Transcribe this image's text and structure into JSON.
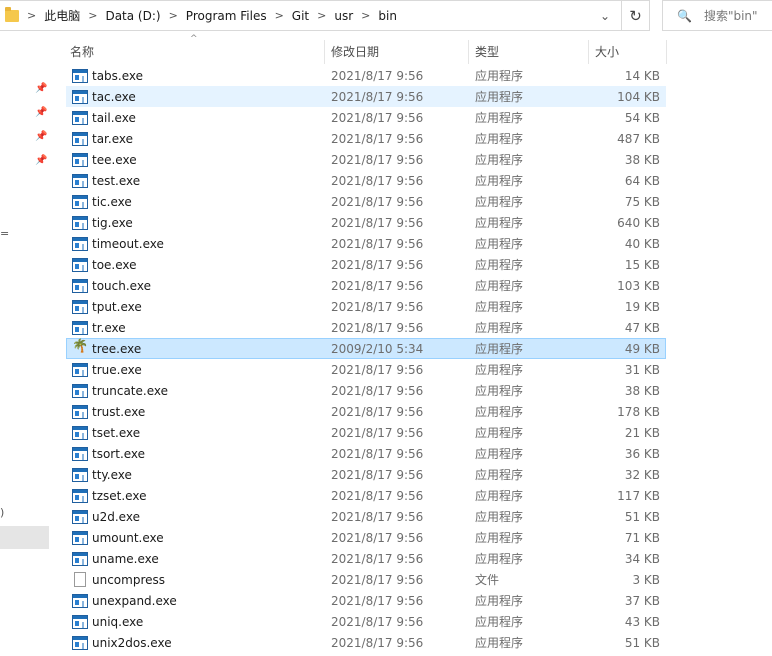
{
  "address_bar": {
    "breadcrumbs": [
      "此电脑",
      "Data (D:)",
      "Program Files",
      "Git",
      "usr",
      "bin"
    ],
    "separator": ">",
    "dropdown_glyph": "⌄",
    "refresh_glyph": "↻",
    "folder_icon": "folder-icon"
  },
  "search": {
    "placeholder": "搜索\"bin\"",
    "icon": "search-icon",
    "glyph": "🔍"
  },
  "nav_fragments": {
    "frag_a": "=",
    "frag_b": ")"
  },
  "columns": {
    "name": "名称",
    "date": "修改日期",
    "type": "类型",
    "size": "大小",
    "sort_indicator": "^"
  },
  "rows": [
    {
      "name": "tabs.exe",
      "date": "2021/8/17 9:56",
      "type": "应用程序",
      "size": "14 KB",
      "icon": "exe-icon"
    },
    {
      "name": "tac.exe",
      "date": "2021/8/17 9:56",
      "type": "应用程序",
      "size": "104 KB",
      "icon": "exe-icon",
      "state": "hover"
    },
    {
      "name": "tail.exe",
      "date": "2021/8/17 9:56",
      "type": "应用程序",
      "size": "54 KB",
      "icon": "exe-icon"
    },
    {
      "name": "tar.exe",
      "date": "2021/8/17 9:56",
      "type": "应用程序",
      "size": "487 KB",
      "icon": "exe-icon"
    },
    {
      "name": "tee.exe",
      "date": "2021/8/17 9:56",
      "type": "应用程序",
      "size": "38 KB",
      "icon": "exe-icon"
    },
    {
      "name": "test.exe",
      "date": "2021/8/17 9:56",
      "type": "应用程序",
      "size": "64 KB",
      "icon": "exe-icon"
    },
    {
      "name": "tic.exe",
      "date": "2021/8/17 9:56",
      "type": "应用程序",
      "size": "75 KB",
      "icon": "exe-icon"
    },
    {
      "name": "tig.exe",
      "date": "2021/8/17 9:56",
      "type": "应用程序",
      "size": "640 KB",
      "icon": "exe-icon"
    },
    {
      "name": "timeout.exe",
      "date": "2021/8/17 9:56",
      "type": "应用程序",
      "size": "40 KB",
      "icon": "exe-icon"
    },
    {
      "name": "toe.exe",
      "date": "2021/8/17 9:56",
      "type": "应用程序",
      "size": "15 KB",
      "icon": "exe-icon"
    },
    {
      "name": "touch.exe",
      "date": "2021/8/17 9:56",
      "type": "应用程序",
      "size": "103 KB",
      "icon": "exe-icon"
    },
    {
      "name": "tput.exe",
      "date": "2021/8/17 9:56",
      "type": "应用程序",
      "size": "19 KB",
      "icon": "exe-icon"
    },
    {
      "name": "tr.exe",
      "date": "2021/8/17 9:56",
      "type": "应用程序",
      "size": "47 KB",
      "icon": "exe-icon"
    },
    {
      "name": "tree.exe",
      "date": "2009/2/10 5:34",
      "type": "应用程序",
      "size": "49 KB",
      "icon": "tree-icon",
      "state": "selected"
    },
    {
      "name": "true.exe",
      "date": "2021/8/17 9:56",
      "type": "应用程序",
      "size": "31 KB",
      "icon": "exe-icon"
    },
    {
      "name": "truncate.exe",
      "date": "2021/8/17 9:56",
      "type": "应用程序",
      "size": "38 KB",
      "icon": "exe-icon"
    },
    {
      "name": "trust.exe",
      "date": "2021/8/17 9:56",
      "type": "应用程序",
      "size": "178 KB",
      "icon": "exe-icon"
    },
    {
      "name": "tset.exe",
      "date": "2021/8/17 9:56",
      "type": "应用程序",
      "size": "21 KB",
      "icon": "exe-icon"
    },
    {
      "name": "tsort.exe",
      "date": "2021/8/17 9:56",
      "type": "应用程序",
      "size": "36 KB",
      "icon": "exe-icon"
    },
    {
      "name": "tty.exe",
      "date": "2021/8/17 9:56",
      "type": "应用程序",
      "size": "32 KB",
      "icon": "exe-icon"
    },
    {
      "name": "tzset.exe",
      "date": "2021/8/17 9:56",
      "type": "应用程序",
      "size": "117 KB",
      "icon": "exe-icon"
    },
    {
      "name": "u2d.exe",
      "date": "2021/8/17 9:56",
      "type": "应用程序",
      "size": "51 KB",
      "icon": "exe-icon"
    },
    {
      "name": "umount.exe",
      "date": "2021/8/17 9:56",
      "type": "应用程序",
      "size": "71 KB",
      "icon": "exe-icon"
    },
    {
      "name": "uname.exe",
      "date": "2021/8/17 9:56",
      "type": "应用程序",
      "size": "34 KB",
      "icon": "exe-icon"
    },
    {
      "name": "uncompress",
      "date": "2021/8/17 9:56",
      "type": "文件",
      "size": "3 KB",
      "icon": "file-icon"
    },
    {
      "name": "unexpand.exe",
      "date": "2021/8/17 9:56",
      "type": "应用程序",
      "size": "37 KB",
      "icon": "exe-icon"
    },
    {
      "name": "uniq.exe",
      "date": "2021/8/17 9:56",
      "type": "应用程序",
      "size": "43 KB",
      "icon": "exe-icon"
    },
    {
      "name": "unix2dos.exe",
      "date": "2021/8/17 9:56",
      "type": "应用程序",
      "size": "51 KB",
      "icon": "exe-icon"
    }
  ],
  "colors": {
    "hover_row": "#e5f3ff",
    "selected_row": "#cce8ff",
    "selected_border": "#99d1ff",
    "secondary_text": "#6d6d6d"
  }
}
